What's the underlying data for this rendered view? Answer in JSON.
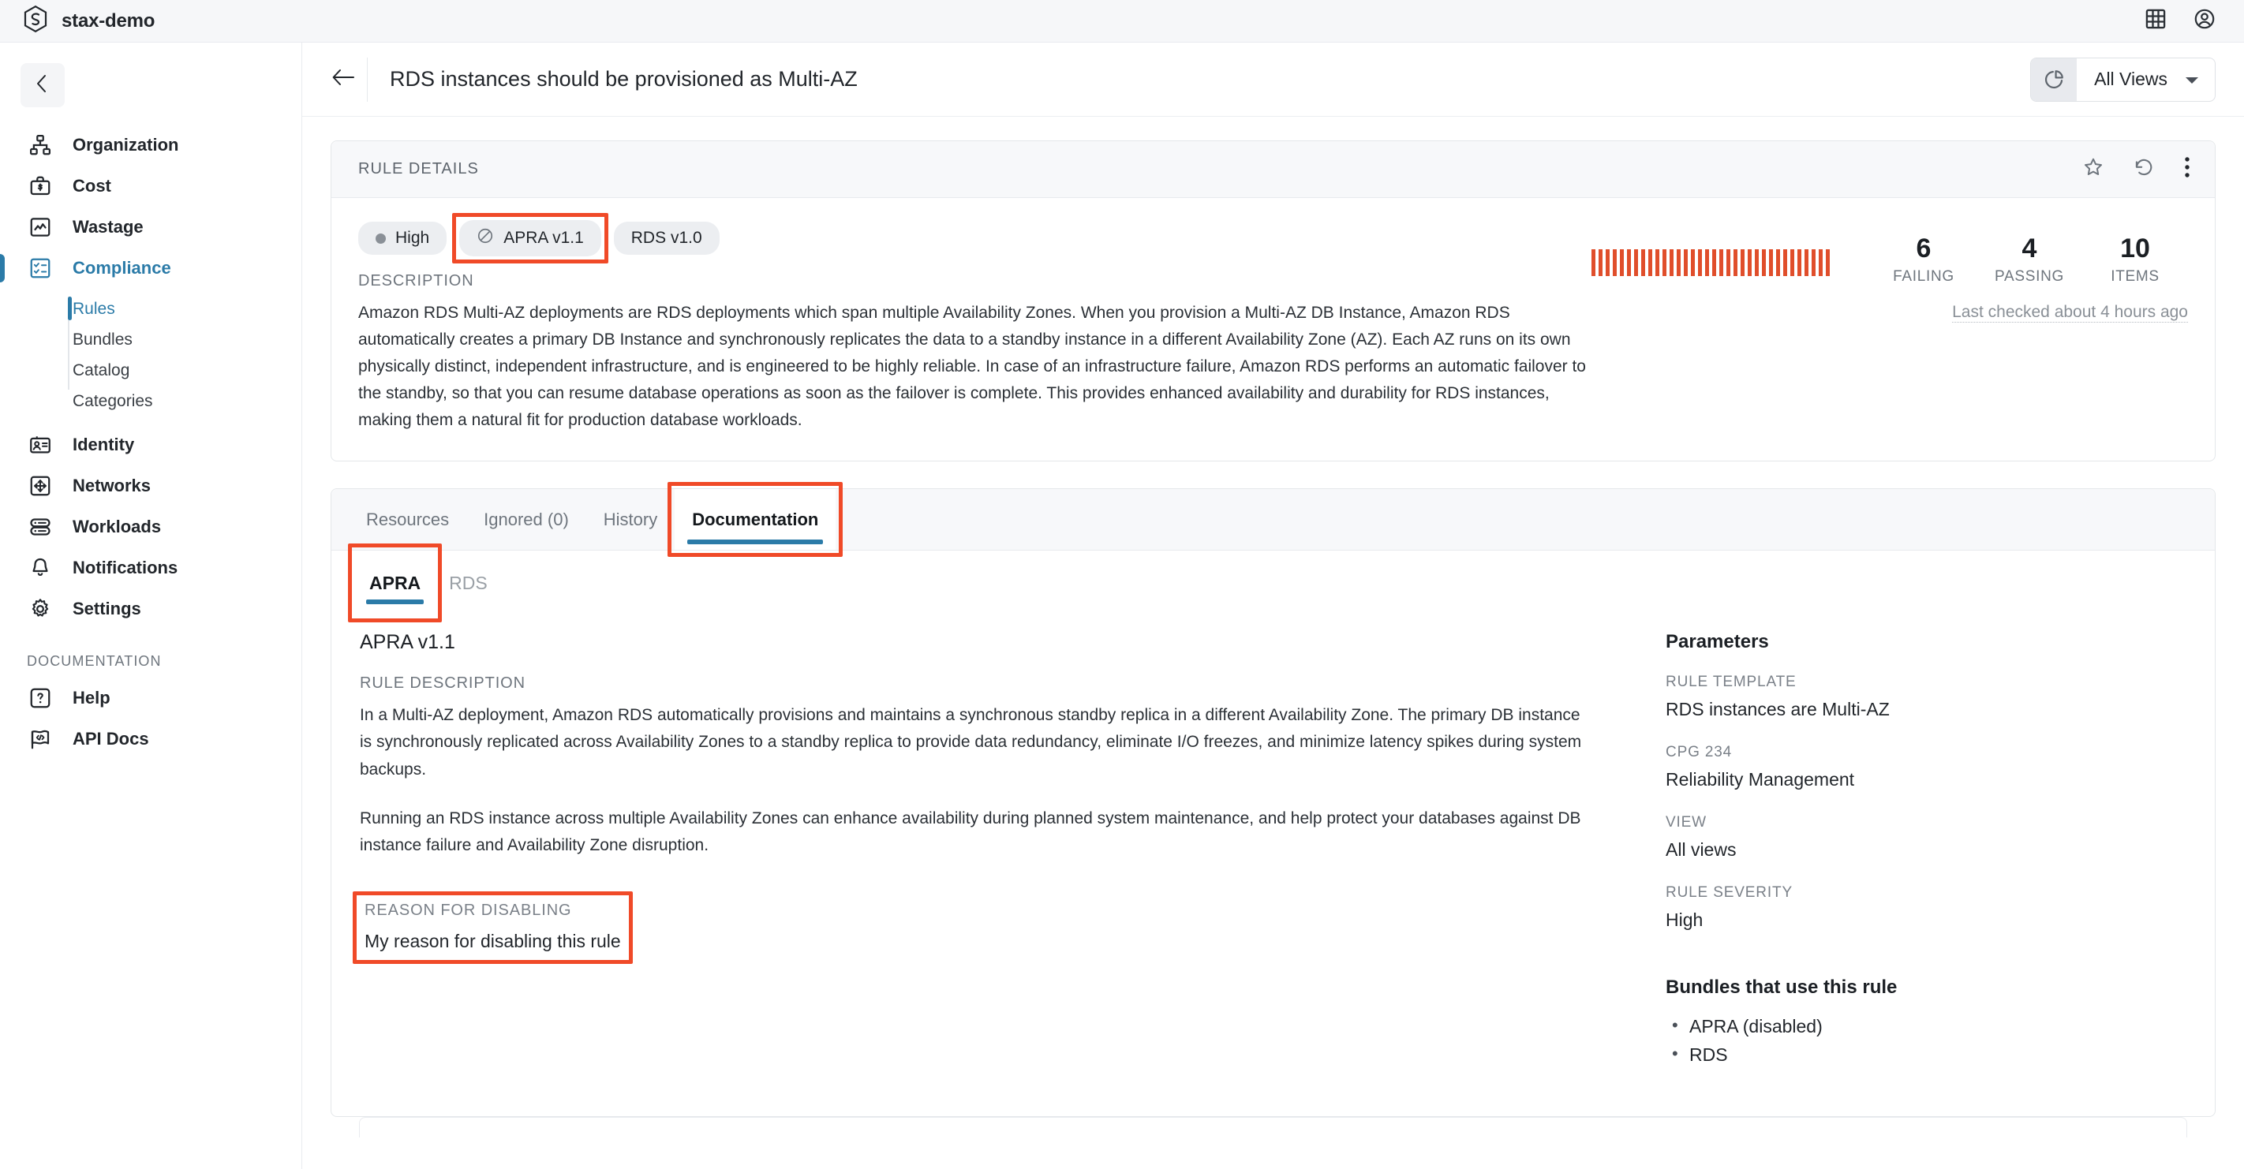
{
  "topbar": {
    "brand_name": "stax-demo",
    "logo_icon": "stax-hexagon-logo",
    "apps_icon": "grid-apps-icon",
    "account_icon": "user-account-icon"
  },
  "sidebar": {
    "collapse_icon": "chevron-left-icon",
    "items": [
      {
        "label": "Organization",
        "icon": "org-chart-icon",
        "active": false
      },
      {
        "label": "Cost",
        "icon": "briefcase-dollar-icon",
        "active": false
      },
      {
        "label": "Wastage",
        "icon": "chart-line-icon",
        "active": false
      },
      {
        "label": "Compliance",
        "icon": "checklist-icon",
        "active": true
      },
      {
        "label": "Identity",
        "icon": "id-card-icon",
        "active": false
      },
      {
        "label": "Networks",
        "icon": "arrows-move-icon",
        "active": false
      },
      {
        "label": "Workloads",
        "icon": "server-stack-icon",
        "active": false
      },
      {
        "label": "Notifications",
        "icon": "bell-icon",
        "active": false
      },
      {
        "label": "Settings",
        "icon": "gear-icon",
        "active": false
      }
    ],
    "subnav": [
      {
        "label": "Rules",
        "active": true
      },
      {
        "label": "Bundles",
        "active": false
      },
      {
        "label": "Catalog",
        "active": false
      },
      {
        "label": "Categories",
        "active": false
      }
    ],
    "section_label": "DOCUMENTATION",
    "doc_items": [
      {
        "label": "Help",
        "icon": "question-box-icon"
      },
      {
        "label": "API Docs",
        "icon": "code-flag-icon"
      }
    ]
  },
  "header": {
    "back_icon": "arrow-left-icon",
    "title": "RDS instances should be provisioned as Multi-AZ",
    "views_icon": "pie-chart-icon",
    "views_label": "All Views",
    "views_caret_icon": "chevron-down-icon"
  },
  "rule_details": {
    "panel_title": "RULE DETAILS",
    "actions": [
      {
        "name": "favorite",
        "icon": "star-icon"
      },
      {
        "name": "history",
        "icon": "refresh-counterclockwise-icon"
      },
      {
        "name": "more",
        "icon": "more-vertical-icon"
      }
    ],
    "badges": [
      {
        "label": "High",
        "icon": "severity-dot-icon",
        "annotated": false
      },
      {
        "label": "APRA v1.1",
        "icon": "disabled-circle-slash-icon",
        "annotated": true
      },
      {
        "label": "RDS v1.0",
        "icon": null,
        "annotated": false
      }
    ],
    "description_label": "DESCRIPTION",
    "description": "Amazon RDS Multi-AZ deployments are RDS deployments which span multiple Availability Zones. When you provision a Multi-AZ DB Instance, Amazon RDS automatically creates a primary DB Instance and synchronously replicates the data to a standby instance in a different Availability Zone (AZ). Each AZ runs on its own physically distinct, independent infrastructure, and is engineered to be highly reliable. In case of an infrastructure failure, Amazon RDS performs an automatic failover to the standby, so that you can resume database operations as soon as the failover is complete. This provides enhanced availability and durability for RDS instances, making them a natural fit for production database workloads.",
    "stats": [
      {
        "value": "6",
        "label": "FAILING"
      },
      {
        "value": "4",
        "label": "PASSING"
      },
      {
        "value": "10",
        "label": "ITEMS"
      }
    ],
    "last_checked": "Last checked about 4 hours ago",
    "sparkline_color": "#e04e2b",
    "sparkline_bars": 34
  },
  "tabs": [
    {
      "label": "Resources",
      "active": false,
      "annotated": false
    },
    {
      "label": "Ignored (0)",
      "active": false,
      "annotated": false
    },
    {
      "label": "History",
      "active": false,
      "annotated": false
    },
    {
      "label": "Documentation",
      "active": true,
      "annotated": true
    }
  ],
  "subtabs": [
    {
      "label": "APRA",
      "active": true,
      "annotated": true
    },
    {
      "label": "RDS",
      "active": false,
      "annotated": false
    }
  ],
  "documentation": {
    "title": "APRA v1.1",
    "rule_description_label": "RULE DESCRIPTION",
    "paragraphs": [
      "In a Multi-AZ deployment, Amazon RDS automatically provisions and maintains a synchronous standby replica in a different Availability Zone. The primary DB instance is synchronously replicated across Availability Zones to a standby replica to provide data redundancy, eliminate I/O freezes, and minimize latency spikes during system backups.",
      "Running an RDS instance across multiple Availability Zones can enhance availability during planned system maintenance, and help protect your databases against DB instance failure and Availability Zone disruption."
    ],
    "reason_label": "REASON FOR DISABLING",
    "reason_value": "My reason for disabling this rule"
  },
  "parameters": {
    "title": "Parameters",
    "fields": [
      {
        "label": "RULE TEMPLATE",
        "value": "RDS instances are Multi-AZ"
      },
      {
        "label": "CPG 234",
        "value": "Reliability Management"
      },
      {
        "label": "VIEW",
        "value": "All views"
      },
      {
        "label": "RULE SEVERITY",
        "value": "High"
      }
    ],
    "bundles_title": "Bundles that use this rule",
    "bundles": [
      "APRA (disabled)",
      "RDS"
    ]
  },
  "colors": {
    "accent_blue": "#2b7ba8",
    "annotation_red": "#f04a28",
    "failing_orange": "#e04e2b"
  }
}
